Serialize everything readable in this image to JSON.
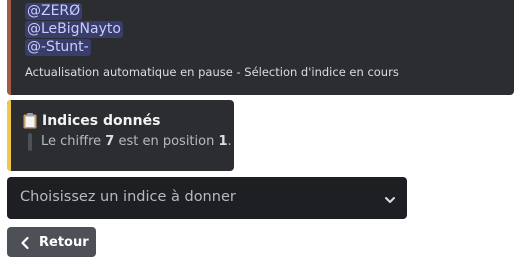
{
  "embed_top": {
    "accent_color": "#a05a45",
    "mentions": [
      "@ZERØ",
      "@LeBigNayto",
      "@-Stunt-"
    ],
    "footer": "Actualisation automatique en pause - Sélection d'indice en cours"
  },
  "hints_embed": {
    "accent_color": "#f0c94a",
    "icon": "clipboard-icon",
    "title": "Indices donnés",
    "quote": {
      "prefix": "Le chiffre ",
      "digit": "7",
      "middle": " est en position ",
      "position": "1",
      "suffix": "."
    }
  },
  "select_menu": {
    "placeholder": "Choisissez un indice à donner",
    "icon": "chevron-down-icon"
  },
  "back_button": {
    "label": "Retour",
    "icon": "chevron-left-icon"
  }
}
